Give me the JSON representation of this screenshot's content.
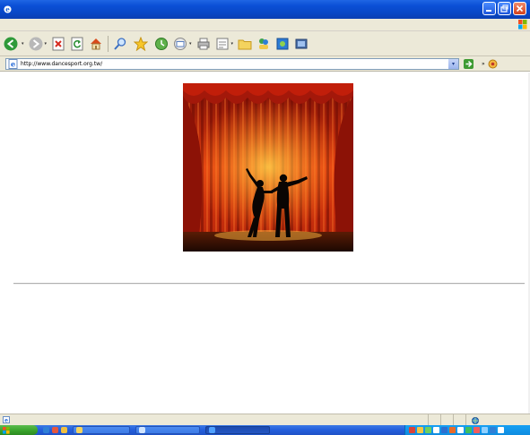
{
  "window": {
    "title": "",
    "controls": [
      "minimize-icon",
      "maximize-icon",
      "close-icon"
    ]
  },
  "menubar": {
    "items": [
      "",
      "",
      "",
      "",
      "",
      ""
    ]
  },
  "toolbar": {
    "back_label": "",
    "search_label": "",
    "favorites_label": ""
  },
  "address": {
    "label": "",
    "url": "http://www.dancesport.org.tw/",
    "go_label": "",
    "links_label": ""
  },
  "content": {
    "image_name": "stage-curtain-dancers",
    "link_text": "",
    "link_color": "#5ac800"
  },
  "statusbar": {
    "text": "",
    "zone_text": ""
  },
  "taskbar": {
    "start_label": "",
    "tasks": [
      {
        "label": "",
        "active": false
      },
      {
        "label": "",
        "active": false
      },
      {
        "label": "",
        "active": true
      }
    ]
  },
  "colors": {
    "titlebar": "#0b4fd6",
    "chrome": "#ece9d8",
    "start": "#37a12a",
    "curtain": "#c8200a",
    "link": "#5ac800"
  }
}
